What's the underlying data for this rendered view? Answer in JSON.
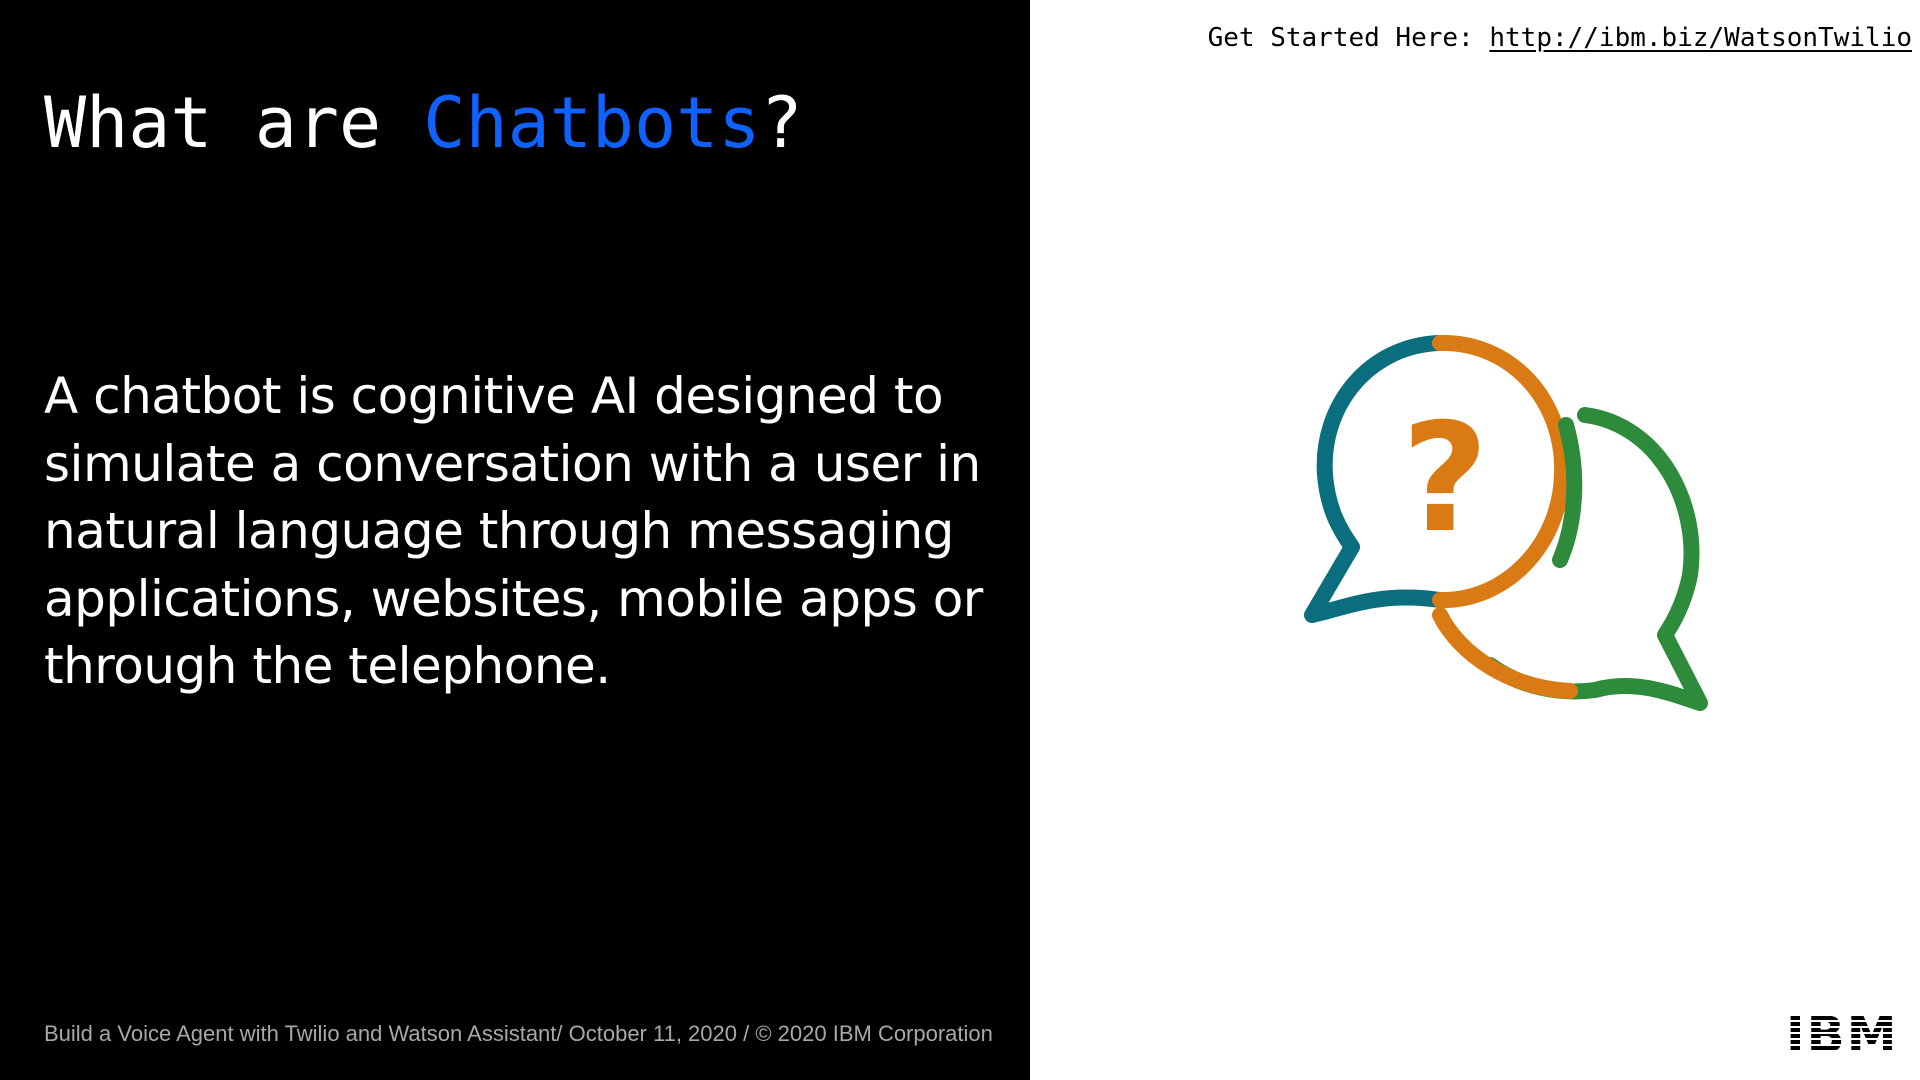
{
  "slide": {
    "title_prefix": "What are ",
    "title_highlight": "Chatbots",
    "title_suffix": "?",
    "body": "A chatbot is cognitive AI designed to simulate a conversation with a user in natural language through messaging applications, websites, mobile apps or through the telephone.",
    "footer": "Build a Voice Agent with Twilio and Watson Assistant/ October 11, 2020 / © 2020 IBM Corporation"
  },
  "get_started": {
    "label": "Get Started Here: ",
    "link_text": "http://ibm.biz/WatsonTwilio"
  },
  "illustration": {
    "icon": "chat-bubbles-question-icon",
    "glyph": "?"
  },
  "logo": {
    "text": "IBM"
  },
  "colors": {
    "background_left": "#000000",
    "background_right": "#ffffff",
    "accent_blue": "#0f62fe",
    "bubble_teal": "#0b6e7e",
    "bubble_orange": "#d97a14",
    "bubble_green": "#2e8b3b",
    "footer_gray": "#a8a8a8"
  }
}
